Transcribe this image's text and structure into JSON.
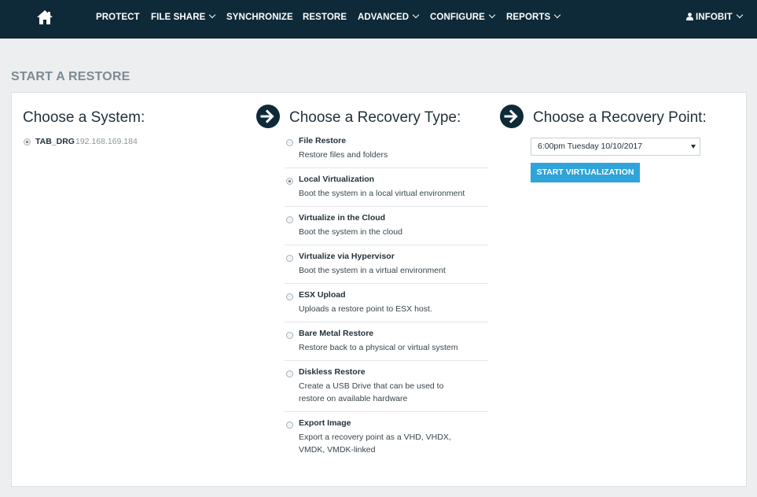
{
  "nav": {
    "items": [
      {
        "label": "PROTECT",
        "dropdown": false
      },
      {
        "label": "FILE SHARE",
        "dropdown": true
      },
      {
        "label": "SYNCHRONIZE",
        "dropdown": false
      },
      {
        "label": "RESTORE",
        "dropdown": false
      },
      {
        "label": "ADVANCED",
        "dropdown": true
      },
      {
        "label": "CONFIGURE",
        "dropdown": true
      },
      {
        "label": "REPORTS",
        "dropdown": true
      }
    ],
    "user": "INFOBIT",
    "icons": {
      "home": "home-icon",
      "user": "user-icon",
      "dropdown": "chevron-down-icon"
    }
  },
  "page": {
    "title": "START A RESTORE"
  },
  "system": {
    "heading": "Choose a System:",
    "items": [
      {
        "name": "TAB_DRG",
        "ip": "192.168.169.184",
        "selected": true
      }
    ]
  },
  "recovery_type": {
    "heading": "Choose a Recovery Type:",
    "options": [
      {
        "title": "File Restore",
        "desc": "Restore files and folders",
        "selected": false
      },
      {
        "title": "Local Virtualization",
        "desc": "Boot the system in a local virtual environment",
        "selected": true
      },
      {
        "title": "Virtualize in the Cloud",
        "desc": "Boot the system in the cloud",
        "selected": false
      },
      {
        "title": "Virtualize via Hypervisor",
        "desc": "Boot the system in a virtual environment",
        "selected": false
      },
      {
        "title": "ESX Upload",
        "desc": "Uploads a restore point to ESX host.",
        "selected": false
      },
      {
        "title": "Bare Metal Restore",
        "desc": "Restore back to a physical or virtual system",
        "selected": false
      },
      {
        "title": "Diskless Restore",
        "desc": "Create a USB Drive that can be used to restore on available hardware",
        "selected": false
      },
      {
        "title": "Export Image",
        "desc": "Export a recovery point as a VHD, VHDX, VMDK, VMDK-linked",
        "selected": false
      }
    ]
  },
  "recovery_point": {
    "heading": "Choose a Recovery Point:",
    "selected": "6:00pm Tuesday 10/10/2017",
    "button": "START VIRTUALIZATION"
  },
  "colors": {
    "nav_bg": "#0e2a38",
    "accent": "#2fa4da",
    "page_bg": "#eceeef"
  }
}
